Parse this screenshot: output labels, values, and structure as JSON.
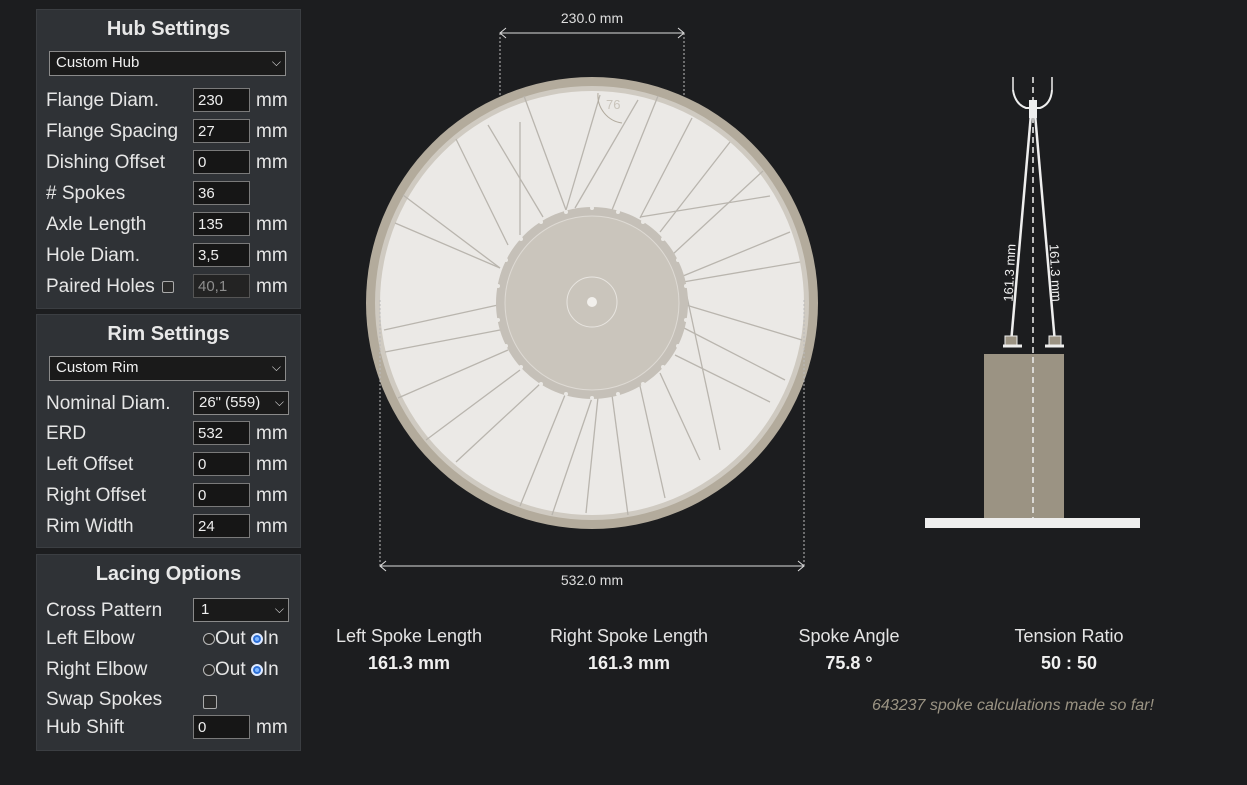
{
  "hub": {
    "title": "Hub Settings",
    "preset": "Custom Hub",
    "fields": [
      {
        "label": "Flange Diam.",
        "value": "230",
        "unit": "mm"
      },
      {
        "label": "Flange Spacing",
        "value": "27",
        "unit": "mm"
      },
      {
        "label": "Dishing Offset",
        "value": "0",
        "unit": "mm"
      },
      {
        "label": "# Spokes",
        "value": "36",
        "unit": ""
      },
      {
        "label": "Axle Length",
        "value": "135",
        "unit": "mm"
      },
      {
        "label": "Hole Diam.",
        "value": "3,5",
        "unit": "mm"
      },
      {
        "label": "Paired Holes",
        "value": "40,1",
        "unit": "mm"
      }
    ]
  },
  "rim": {
    "title": "Rim Settings",
    "preset": "Custom Rim",
    "nominal_label": "Nominal Diam.",
    "nominal_value": "26\" (559)",
    "fields": [
      {
        "label": "ERD",
        "value": "532",
        "unit": "mm"
      },
      {
        "label": "Left Offset",
        "value": "0",
        "unit": "mm"
      },
      {
        "label": "Right Offset",
        "value": "0",
        "unit": "mm"
      },
      {
        "label": "Rim Width",
        "value": "24",
        "unit": "mm"
      }
    ]
  },
  "lacing": {
    "title": "Lacing Options",
    "cross_label": "Cross Pattern",
    "cross_value": "1",
    "left_elbow_label": "Left Elbow",
    "right_elbow_label": "Right Elbow",
    "out_label": "Out",
    "in_label": "In",
    "swap_label": "Swap Spokes",
    "hub_shift_label": "Hub Shift",
    "hub_shift_value": "0",
    "hub_shift_unit": "mm"
  },
  "diagram": {
    "flange_dim": "230.0 mm",
    "erd_dim": "532.0 mm",
    "angle_mark": "76",
    "left_side_len": "161.3 mm",
    "right_side_len": "161.3 mm"
  },
  "results": [
    {
      "title": "Left Spoke Length",
      "value": "161.3 mm"
    },
    {
      "title": "Right Spoke Length",
      "value": "161.3 mm"
    },
    {
      "title": "Spoke Angle",
      "value": "75.8 °"
    },
    {
      "title": "Tension Ratio",
      "value": "50 : 50"
    }
  ],
  "counter_text": "643237 spoke calculations made so far!",
  "colors": {
    "background": "#1c1d1f",
    "panel": "#2f3236",
    "rim": "#b3ab9c",
    "hub": "#c9c4bb",
    "counter": "#9a9383",
    "radio_selected": "#2d6fd6"
  }
}
